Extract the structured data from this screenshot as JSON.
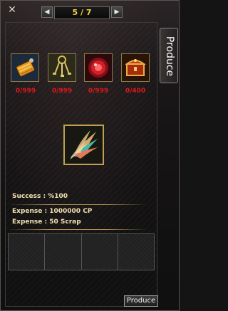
{
  "window": {
    "close_glyph": "✕",
    "pager": {
      "prev_glyph": "◀",
      "next_glyph": "▶",
      "page_text": "5 / 7"
    },
    "side_tab_label": "Produce"
  },
  "materials": [
    {
      "name": "orange-tag-bundle",
      "icon": "orange-tag-bundle-icon",
      "count": "0/999"
    },
    {
      "name": "key-ring",
      "icon": "key-ring-icon",
      "count": "0/999"
    },
    {
      "name": "red-orb",
      "icon": "red-orb-icon",
      "count": "0/999"
    },
    {
      "name": "jewel-chest",
      "icon": "jewel-chest-icon",
      "count": "0/400"
    }
  ],
  "result_item": {
    "icon": "feather-wing-icon"
  },
  "info": {
    "success": "Success : %100",
    "expense_cp": "Expense : 1000000 CP",
    "expense_scrap": "Expense : 50 Scrap"
  },
  "buttons": {
    "produce": "Produce"
  },
  "colors": {
    "count_red": "#e01818",
    "page_yellow": "#f2cf3a",
    "info_text": "#f0e0b0",
    "slot_border": "#8b7a4a"
  }
}
